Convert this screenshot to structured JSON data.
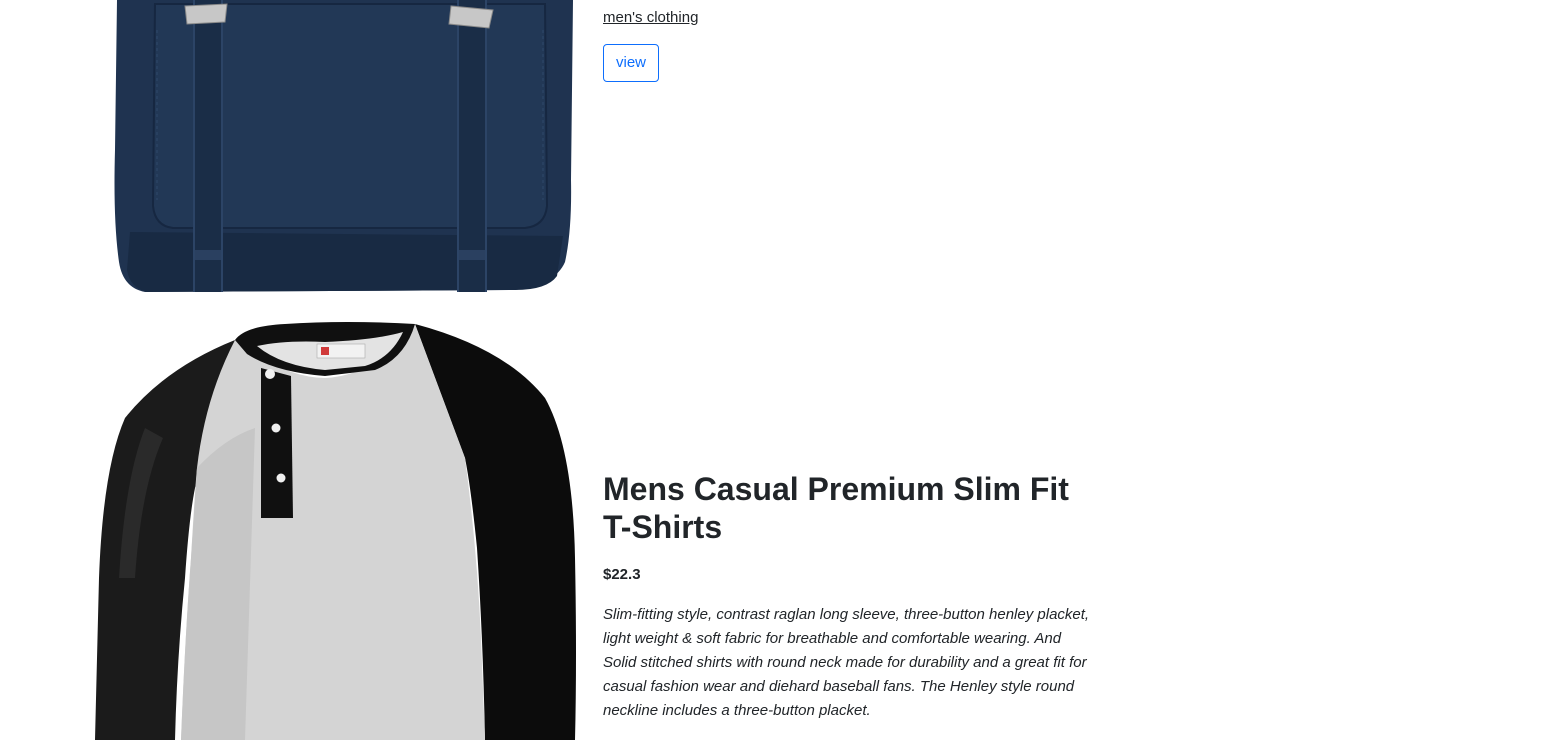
{
  "products": [
    {
      "category": "men's clothing",
      "view_label": "view",
      "image_icon": "backpack-image"
    },
    {
      "title": "Mens Casual Premium Slim Fit T-Shirts",
      "price": "$22.3",
      "description": "Slim-fitting style, contrast raglan long sleeve, three-button henley placket, light weight & soft fabric for breathable and comfortable wearing. And Solid stitched shirts with round neck made for durability and a great fit for casual fashion wear and diehard baseball fans. The Henley style round neckline includes a three-button placket.",
      "image_icon": "tshirt-image"
    }
  ],
  "colors": {
    "primary": "#0d6efd",
    "text": "#212529",
    "backpack_navy": "#1f3350",
    "shirt_gray": "#d9d9d9",
    "shirt_black": "#111111"
  }
}
